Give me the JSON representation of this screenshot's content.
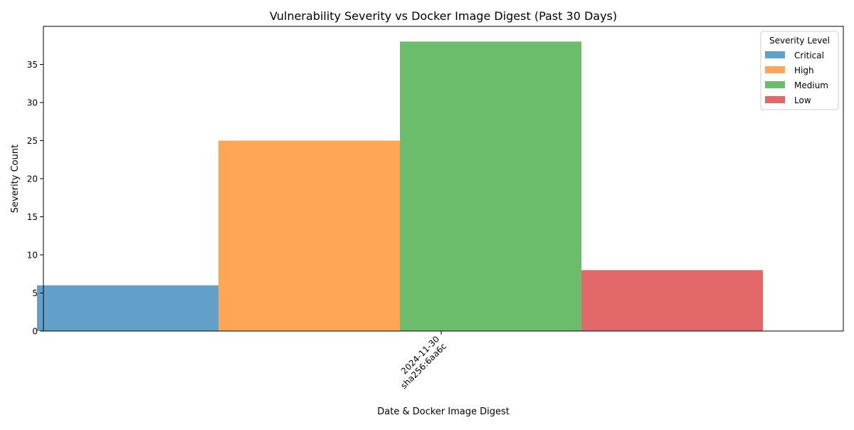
{
  "chart_data": {
    "type": "bar",
    "title": "Vulnerability Severity vs Docker Image Digest (Past 30 Days)",
    "xlabel": "Date & Docker Image Digest",
    "ylabel": "Severity Count",
    "categories": [
      {
        "line1": "2024-11-30",
        "line2": "sha256:6aa6c"
      }
    ],
    "series": [
      {
        "name": "Critical",
        "color": "#1f77b4",
        "values": [
          6
        ]
      },
      {
        "name": "High",
        "color": "#ff7f0e",
        "values": [
          25
        ]
      },
      {
        "name": "Medium",
        "color": "#2ca02c",
        "values": [
          38
        ]
      },
      {
        "name": "Low",
        "color": "#d62728",
        "values": [
          8
        ]
      }
    ],
    "ylim": [
      0,
      40
    ],
    "yticks": [
      "0",
      "5",
      "10",
      "15",
      "20",
      "25",
      "30",
      "35"
    ],
    "bar_opacity": 0.7,
    "grid": false,
    "legend": {
      "title": "Severity Level",
      "placement": "top-right"
    }
  }
}
